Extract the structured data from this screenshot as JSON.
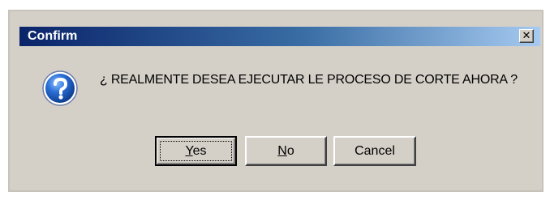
{
  "window": {
    "title": "Confirm",
    "close_glyph": "✕"
  },
  "dialog": {
    "icon": "question-icon",
    "message": "¿ REALMENTE DESEA EJECUTAR LE PROCESO DE CORTE AHORA ?"
  },
  "buttons": {
    "yes": {
      "mnemonic": "Y",
      "rest": "es"
    },
    "no": {
      "mnemonic": "N",
      "rest": "o"
    },
    "cancel": {
      "label": "Cancel"
    }
  },
  "colors": {
    "titlebar_start": "#0a246a",
    "titlebar_end": "#a6caf0",
    "face": "#d4d0c8",
    "icon_blue": "#1f5fbf"
  }
}
